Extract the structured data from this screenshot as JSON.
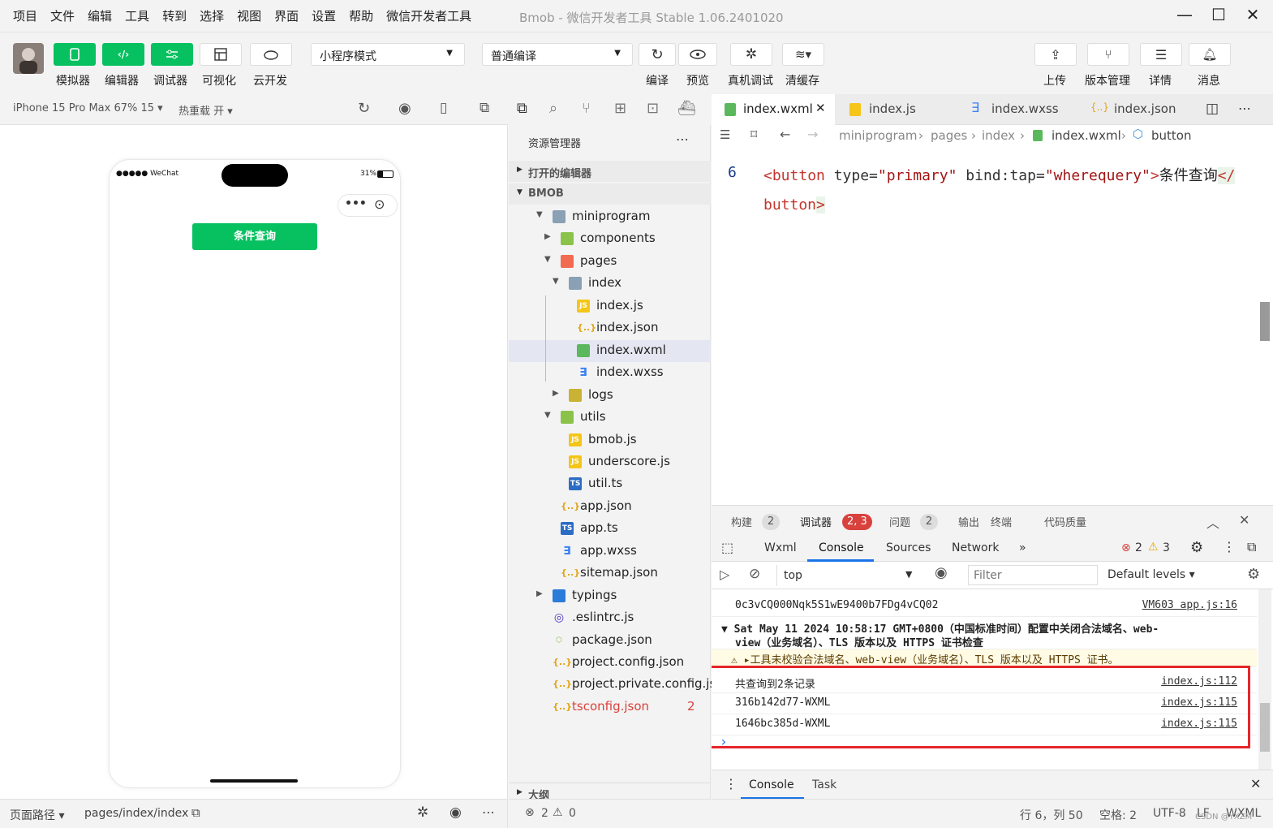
{
  "menu": [
    "项目",
    "文件",
    "编辑",
    "工具",
    "转到",
    "选择",
    "视图",
    "界面",
    "设置",
    "帮助",
    "微信开发者工具"
  ],
  "window_title": "Bmob - 微信开发者工具 Stable 1.06.2401020",
  "toolbar": {
    "simulator": "模拟器",
    "editor": "编辑器",
    "debugger": "调试器",
    "visual": "可视化",
    "cloud": "云开发",
    "mode_select": "小程序模式",
    "compile_select": "普通编译",
    "compile": "编译",
    "preview": "预览",
    "remote_debug": "真机调试",
    "clear_cache": "清缓存",
    "upload": "上传",
    "version": "版本管理",
    "details": "详情",
    "messages": "消息"
  },
  "simulator": {
    "device": "iPhone 15 Pro Max 67% 15 ▾",
    "hot_reload": "热重载 开 ▾",
    "status_left": "●●●●● WeChat",
    "battery": "31%",
    "query_button": "条件查询",
    "path_label": "页面路径 ▾",
    "path": "pages/index/index"
  },
  "explorer": {
    "title": "资源管理器",
    "open_editors": "打开的编辑器",
    "project": "BMOB",
    "outline": "大纲",
    "errors": "2",
    "warnings": "0",
    "tree": [
      {
        "label": "miniprogram",
        "type": "folder",
        "depth": 1,
        "arrow": "▼"
      },
      {
        "label": "components",
        "type": "folderg",
        "depth": 2,
        "arrow": "▶"
      },
      {
        "label": "pages",
        "type": "folderr",
        "depth": 2,
        "arrow": "▼"
      },
      {
        "label": "index",
        "type": "folder",
        "depth": 3,
        "arrow": "▼"
      },
      {
        "label": "index.js",
        "type": "js",
        "depth": 4,
        "arrow": ""
      },
      {
        "label": "index.json",
        "type": "json",
        "depth": 4,
        "arrow": ""
      },
      {
        "label": "index.wxml",
        "type": "wxml",
        "depth": 4,
        "arrow": "",
        "selected": true
      },
      {
        "label": "index.wxss",
        "type": "wxss",
        "depth": 4,
        "arrow": ""
      },
      {
        "label": "logs",
        "type": "foldery",
        "depth": 3,
        "arrow": "▶"
      },
      {
        "label": "utils",
        "type": "folderg",
        "depth": 2,
        "arrow": "▼"
      },
      {
        "label": "bmob.js",
        "type": "js",
        "depth": 3,
        "arrow": ""
      },
      {
        "label": "underscore.js",
        "type": "js",
        "depth": 3,
        "arrow": ""
      },
      {
        "label": "util.ts",
        "type": "ts",
        "depth": 3,
        "arrow": ""
      },
      {
        "label": "app.json",
        "type": "json",
        "depth": 2,
        "arrow": ""
      },
      {
        "label": "app.ts",
        "type": "ts",
        "depth": 2,
        "arrow": ""
      },
      {
        "label": "app.wxss",
        "type": "wxss",
        "depth": 2,
        "arrow": ""
      },
      {
        "label": "sitemap.json",
        "type": "json",
        "depth": 2,
        "arrow": ""
      },
      {
        "label": "typings",
        "type": "folderb",
        "depth": 1,
        "arrow": "▶"
      },
      {
        "label": ".eslintrc.js",
        "type": "esl",
        "depth": 1,
        "arrow": ""
      },
      {
        "label": "package.json",
        "type": "pkg",
        "depth": 1,
        "arrow": ""
      },
      {
        "label": "project.config.json",
        "type": "json",
        "depth": 1,
        "arrow": ""
      },
      {
        "label": "project.private.config.js...",
        "type": "json",
        "depth": 1,
        "arrow": ""
      },
      {
        "label": "tsconfig.json",
        "type": "json",
        "depth": 1,
        "arrow": "",
        "red": true,
        "count": "2"
      }
    ]
  },
  "editor": {
    "tabs": [
      "index.wxml",
      "index.js",
      "index.wxss",
      "index.json"
    ],
    "breadcrumb": [
      "miniprogram",
      "pages",
      "index",
      "index.wxml",
      "button"
    ],
    "line_number": "6",
    "code": {
      "open": "<",
      "tag": "button",
      "attr1": " type=",
      "val1": "\"primary\"",
      "attr2": " bind:tap=",
      "val2": "\"wherequery\"",
      "close": ">",
      "text": "条件查询",
      "end_open": "</",
      "end_tag": "button",
      "end_close": ">"
    }
  },
  "devtools": {
    "tabs": {
      "build": "构建",
      "build_count": "2",
      "debugger": "调试器",
      "debugger_count": "2, 3",
      "issues": "问题",
      "issues_count": "2",
      "output": "输出",
      "terminal": "终端",
      "quality": "代码质量"
    },
    "console_tabs": [
      "Wxml",
      "Console",
      "Sources",
      "Network"
    ],
    "more": "»",
    "error_count": "2",
    "warn_count": "3",
    "context": "top",
    "filter_placeholder": "Filter",
    "levels": "Default levels ▾",
    "logs": [
      {
        "text": "0c3vCQ000Nqk5S1wE9400b7FDg4vCQ02",
        "src": "VM603 app.js:16"
      },
      {
        "text": "▼ Sat May 11 2024 10:58:17 GMT+0800（中国标准时间）配置中关闭合法域名、web-",
        "text2": "view（业务域名）、TLS 版本以及 HTTPS 证书检查",
        "src": ""
      },
      {
        "text": "⚠ ▸工具未校验合法域名、web-view（业务域名）、TLS 版本以及 HTTPS 证书。",
        "src": ""
      },
      {
        "text": "共查询到2条记录",
        "src": "index.js:112"
      },
      {
        "text": "316b142d77-WXML",
        "src": "index.js:115"
      },
      {
        "text": "1646bc385d-WXML",
        "src": "index.js:115"
      }
    ],
    "prompt": "›",
    "drawer_tabs": [
      "Console",
      "Task"
    ]
  },
  "statusbar": {
    "position": "行 6，列 50",
    "spaces": "空格: 2",
    "encoding": "UTF-8",
    "eol": "LF",
    "lang": "WXML",
    "watermark": "CSDN @YXZM"
  },
  "colors": {
    "green": "#07c160",
    "highlight": "#e5262b",
    "tag": "#c3352e",
    "string": "#a31515"
  }
}
